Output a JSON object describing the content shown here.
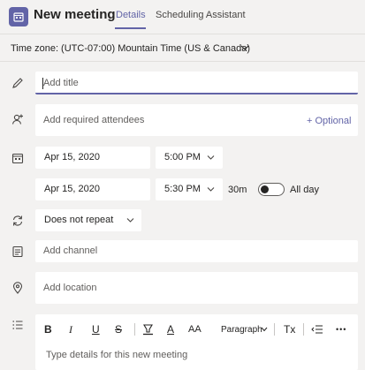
{
  "header": {
    "title": "New meeting",
    "tabs": [
      "Details",
      "Scheduling Assistant"
    ]
  },
  "timezone": {
    "label": "Time zone: (UTC-07:00) Mountain Time (US & Canada)"
  },
  "form": {
    "title_placeholder": "Add title",
    "attendees_placeholder": "Add required attendees",
    "optional_label": "+ Optional",
    "start_date": "Apr 15, 2020",
    "start_time": "5:00 PM",
    "end_date": "Apr 15, 2020",
    "end_time": "5:30 PM",
    "duration": "30m",
    "all_day_label": "All day",
    "all_day_on": false,
    "repeat": "Does not repeat",
    "channel_placeholder": "Add channel",
    "location_placeholder": "Add location"
  },
  "editor": {
    "toolbar": {
      "bold": "B",
      "italic": "I",
      "underline": "U",
      "strikethrough": "S",
      "font_color": "A",
      "font_size": "AA",
      "paragraph": "Paragraph",
      "clear_format": "Tx",
      "more": "•••"
    },
    "placeholder": "Type details for this new meeting"
  },
  "colors": {
    "accent": "#6264a7",
    "background": "#f3f2f1",
    "field": "#ffffff"
  }
}
